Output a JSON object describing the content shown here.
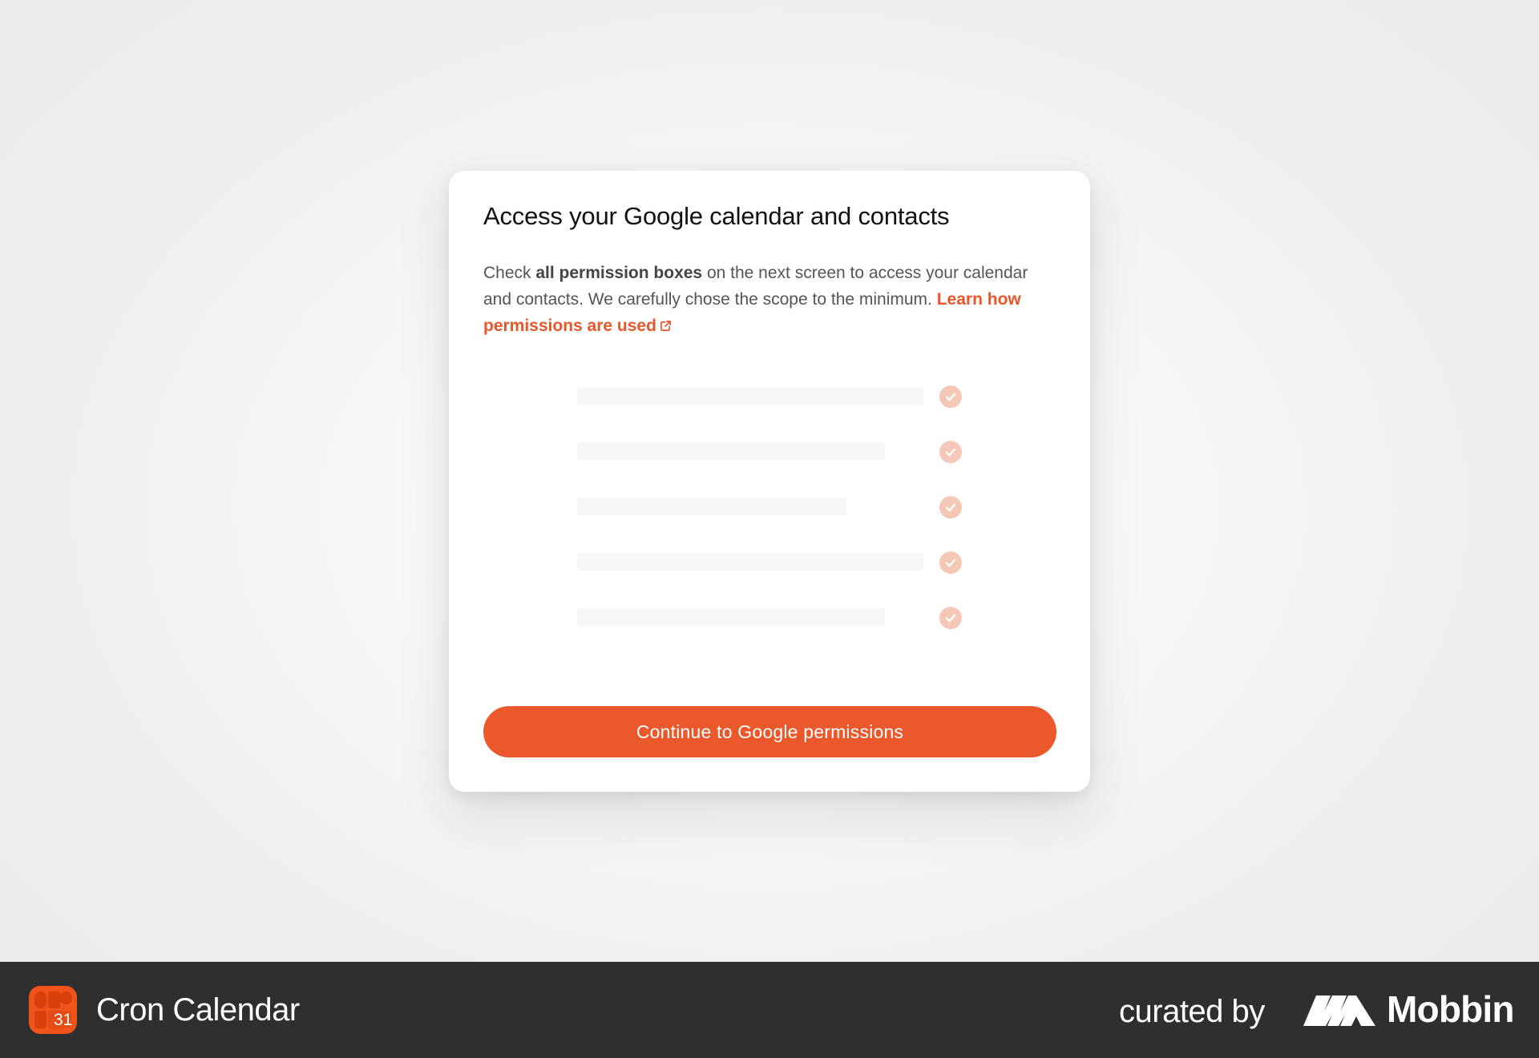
{
  "dialog": {
    "title": "Access your Google calendar and contacts",
    "desc_prefix": "Check ",
    "desc_bold": "all permission boxes",
    "desc_middle": " on the next screen to access your calendar and contacts. We carefully chose the scope to the minimum. ",
    "learn_link": "Learn how permissions are used",
    "permissions": [
      {
        "bar_fraction": 0.72,
        "checked": true
      },
      {
        "bar_fraction": 0.64,
        "checked": true
      },
      {
        "bar_fraction": 0.56,
        "checked": true
      },
      {
        "bar_fraction": 0.72,
        "checked": true
      },
      {
        "bar_fraction": 0.64,
        "checked": true
      }
    ],
    "cta_label": "Continue to Google permissions"
  },
  "footer": {
    "app_icon_number": "31",
    "app_name": "Cron Calendar",
    "curated_by": "curated by",
    "brand": "Mobbin"
  },
  "colors": {
    "accent": "#ea582b",
    "check_bg": "#f4c7b7",
    "footer_bg": "#2f2f2f",
    "app_icon_bg": "#f0531c"
  },
  "icons": {
    "external_link": "external-link-icon",
    "check": "check-circle-icon",
    "app": "cron-app-icon",
    "brand": "mobbin-logo-icon"
  }
}
